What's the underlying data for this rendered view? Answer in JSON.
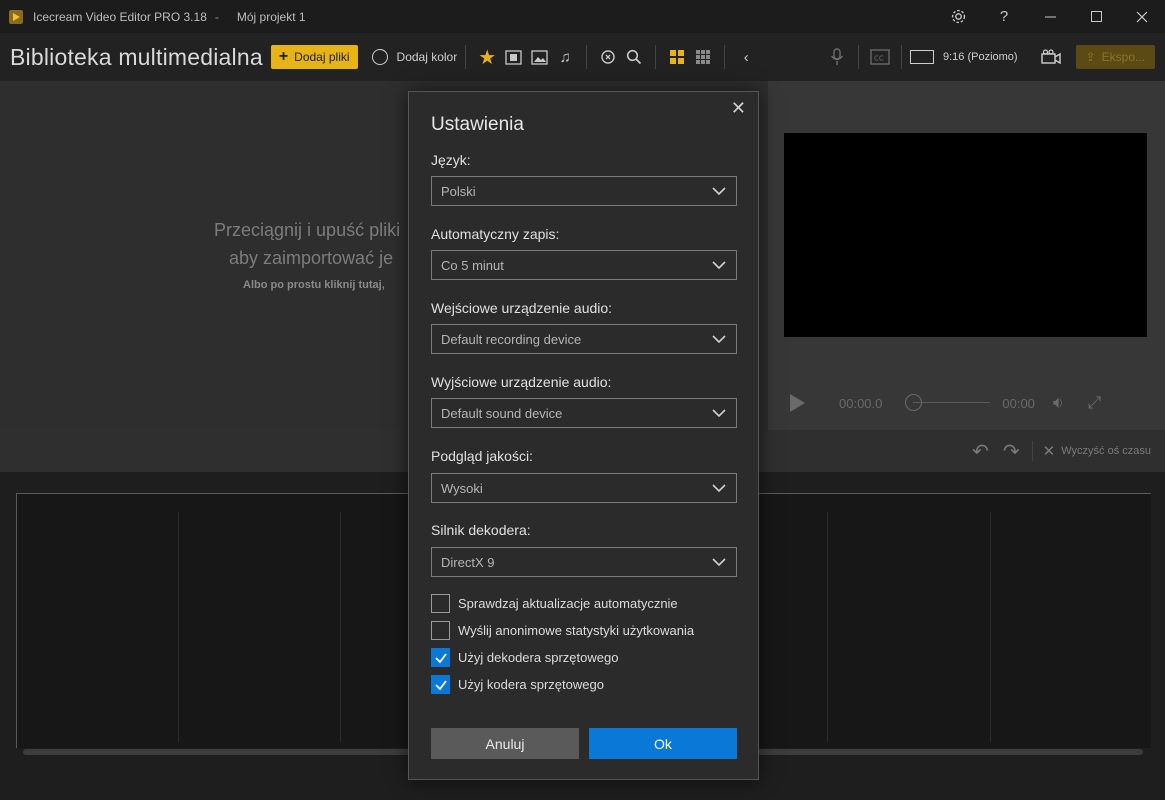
{
  "window": {
    "title": "Icecream Video Editor PRO 3.18",
    "separator": "-",
    "project": "Mój projekt 1",
    "settings_icon": "gear-icon",
    "help_label": "?"
  },
  "toolbar": {
    "library_title": "Biblioteka multimedialna",
    "add_files": "Dodaj pliki",
    "add_color": "Dodaj kolor",
    "aspect_ratio": "9:16 (Poziomo)",
    "export": "Ekspo..."
  },
  "dropzone": {
    "line1": "Przeciągnij i upuść pliki",
    "line2": "aby zaimportować je",
    "line3": "Albo po prostu kliknij tutaj,"
  },
  "player": {
    "time_current": "00:00.0",
    "time_total": "00:00"
  },
  "timeline": {
    "clear_label": "Wyczyść oś czasu"
  },
  "settings": {
    "title": "Ustawienia",
    "fields": [
      {
        "label": "Język:",
        "value": "Polski"
      },
      {
        "label": "Automatyczny zapis:",
        "value": "Co 5 minut"
      },
      {
        "label": "Wejściowe urządzenie audio:",
        "value": "Default recording device"
      },
      {
        "label": "Wyjściowe urządzenie audio:",
        "value": "Default sound device"
      },
      {
        "label": "Podgląd jakości:",
        "value": "Wysoki"
      },
      {
        "label": "Silnik dekodera:",
        "value": "DirectX 9"
      }
    ],
    "checkboxes": [
      {
        "label": "Sprawdzaj aktualizacje automatycznie",
        "checked": false
      },
      {
        "label": "Wyślij anonimowe statystyki użytkowania",
        "checked": false
      },
      {
        "label": "Użyj dekodera sprzętowego",
        "checked": true
      },
      {
        "label": "Użyj kodera sprzętowego",
        "checked": true
      }
    ],
    "cancel": "Anuluj",
    "ok": "Ok"
  },
  "colors": {
    "accent": "#e7b417",
    "primary_button": "#0a78d7"
  }
}
